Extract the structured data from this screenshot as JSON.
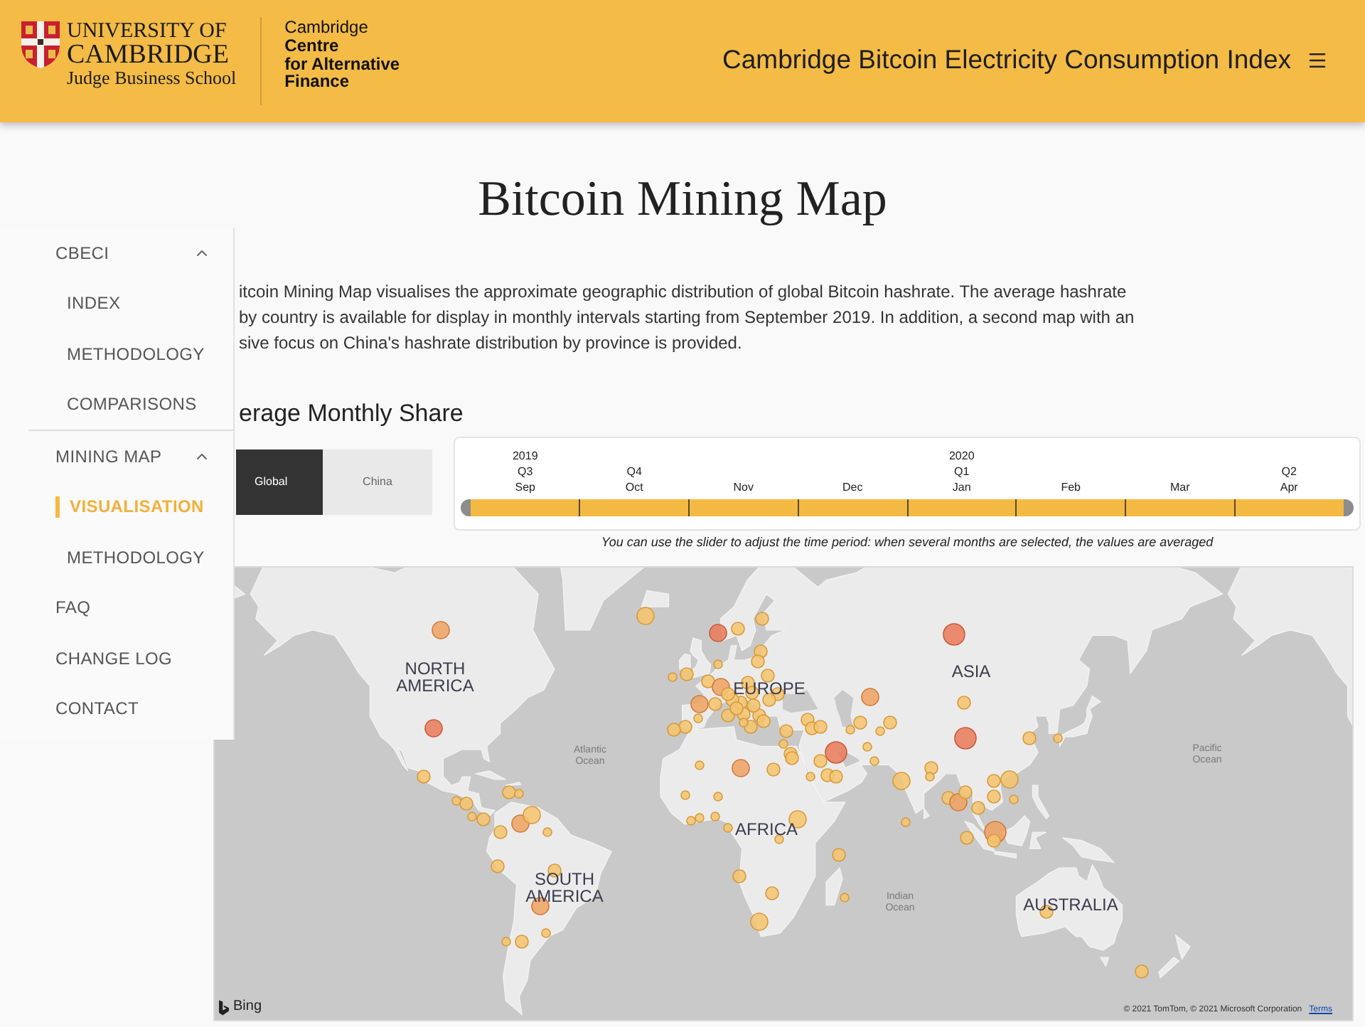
{
  "header": {
    "university_lines": [
      "UNIVERSITY OF",
      "CAMBRIDGE"
    ],
    "school": "Judge Business School",
    "centre_prefix": "Cambridge",
    "centre_lines": [
      "Centre",
      "for Alternative",
      "Finance"
    ],
    "title": "Cambridge Bitcoin Electricity Consumption Index"
  },
  "page_title": "Bitcoin Mining Map",
  "sidebar": {
    "items": [
      {
        "label": "CBECI",
        "selected": false,
        "expanded": true,
        "children": [
          {
            "label": "INDEX",
            "selected": false
          },
          {
            "label": "METHODOLOGY",
            "selected": false
          },
          {
            "label": "COMPARISONS",
            "selected": false
          }
        ]
      },
      {
        "label": "MINING MAP",
        "selected": false,
        "expanded": true,
        "children": [
          {
            "label": "VISUALISATION",
            "selected": true
          },
          {
            "label": "METHODOLOGY",
            "selected": false
          }
        ]
      },
      {
        "label": "FAQ",
        "selected": false
      },
      {
        "label": "CHANGE LOG",
        "selected": false
      },
      {
        "label": "CONTACT",
        "selected": false
      }
    ]
  },
  "intro_lines": [
    "itcoin Mining Map visualises the approximate geographic distribution of global Bitcoin hashrate. The average hashrate",
    "by country is available for display in monthly intervals starting from September 2019. In addition, a second map with an",
    "sive focus on China's hashrate distribution by province is provided."
  ],
  "section_heading": "erage Monthly Share",
  "map_toggle": [
    {
      "label": "Global",
      "selected": true
    },
    {
      "label": "China",
      "selected": false
    }
  ],
  "timeline": {
    "months": [
      {
        "year": "2019",
        "quarter": "Q3",
        "label": "Sep",
        "selected": true
      },
      {
        "quarter": "Q4",
        "label": "Oct",
        "selected": true
      },
      {
        "label": "Nov",
        "selected": true
      },
      {
        "label": "Dec",
        "selected": true
      },
      {
        "year": "2020",
        "quarter": "Q1",
        "label": "Jan",
        "selected": true
      },
      {
        "label": "Feb",
        "selected": true
      },
      {
        "label": "Mar",
        "selected": true
      },
      {
        "quarter": "Q2",
        "label": "Apr",
        "selected": true
      }
    ],
    "caption": "You can use the slider to adjust the time period: when several months are selected, the values are averaged"
  },
  "map": {
    "labels": [
      {
        "text": "NORTH AMERICA",
        "kind": "continent"
      },
      {
        "text": "EUROPE",
        "kind": "continent"
      },
      {
        "text": "ASIA",
        "kind": "continent"
      },
      {
        "text": "Atlantic Ocean",
        "kind": "ocean"
      },
      {
        "text": "Pacific Ocean",
        "kind": "ocean"
      },
      {
        "text": "AFRICA",
        "kind": "continent"
      },
      {
        "text": "SOUTH AMERICA",
        "kind": "continent"
      },
      {
        "text": "Indian Ocean",
        "kind": "ocean"
      },
      {
        "text": "AUSTRALIA",
        "kind": "continent"
      }
    ],
    "attribution": {
      "brand": "Bing",
      "copyright": "© 2021 TomTom, © 2021 Microsoft Corporation",
      "link": "Terms"
    }
  }
}
